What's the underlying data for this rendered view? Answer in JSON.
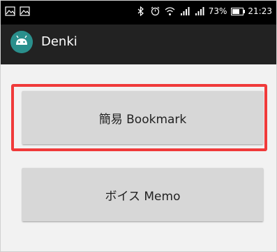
{
  "status_bar": {
    "battery_percent": "73%",
    "time": "21:23",
    "left_icons": [
      "image-icon",
      "image-icon"
    ],
    "right_icons": [
      "bluetooth-icon",
      "alarm-icon",
      "wifi-icon",
      "signal-icon",
      "signal-icon",
      "battery-icon"
    ]
  },
  "app_bar": {
    "title": "Denki",
    "logo_icon": "android-icon",
    "background": "#222222"
  },
  "buttons": {
    "bookmark_label": "簡易 Bookmark",
    "voice_label": "ボイス Memo"
  },
  "colors": {
    "button": "#d7d7d7",
    "highlight": "#f03a3a",
    "content_bg": "#f2f2f2"
  }
}
